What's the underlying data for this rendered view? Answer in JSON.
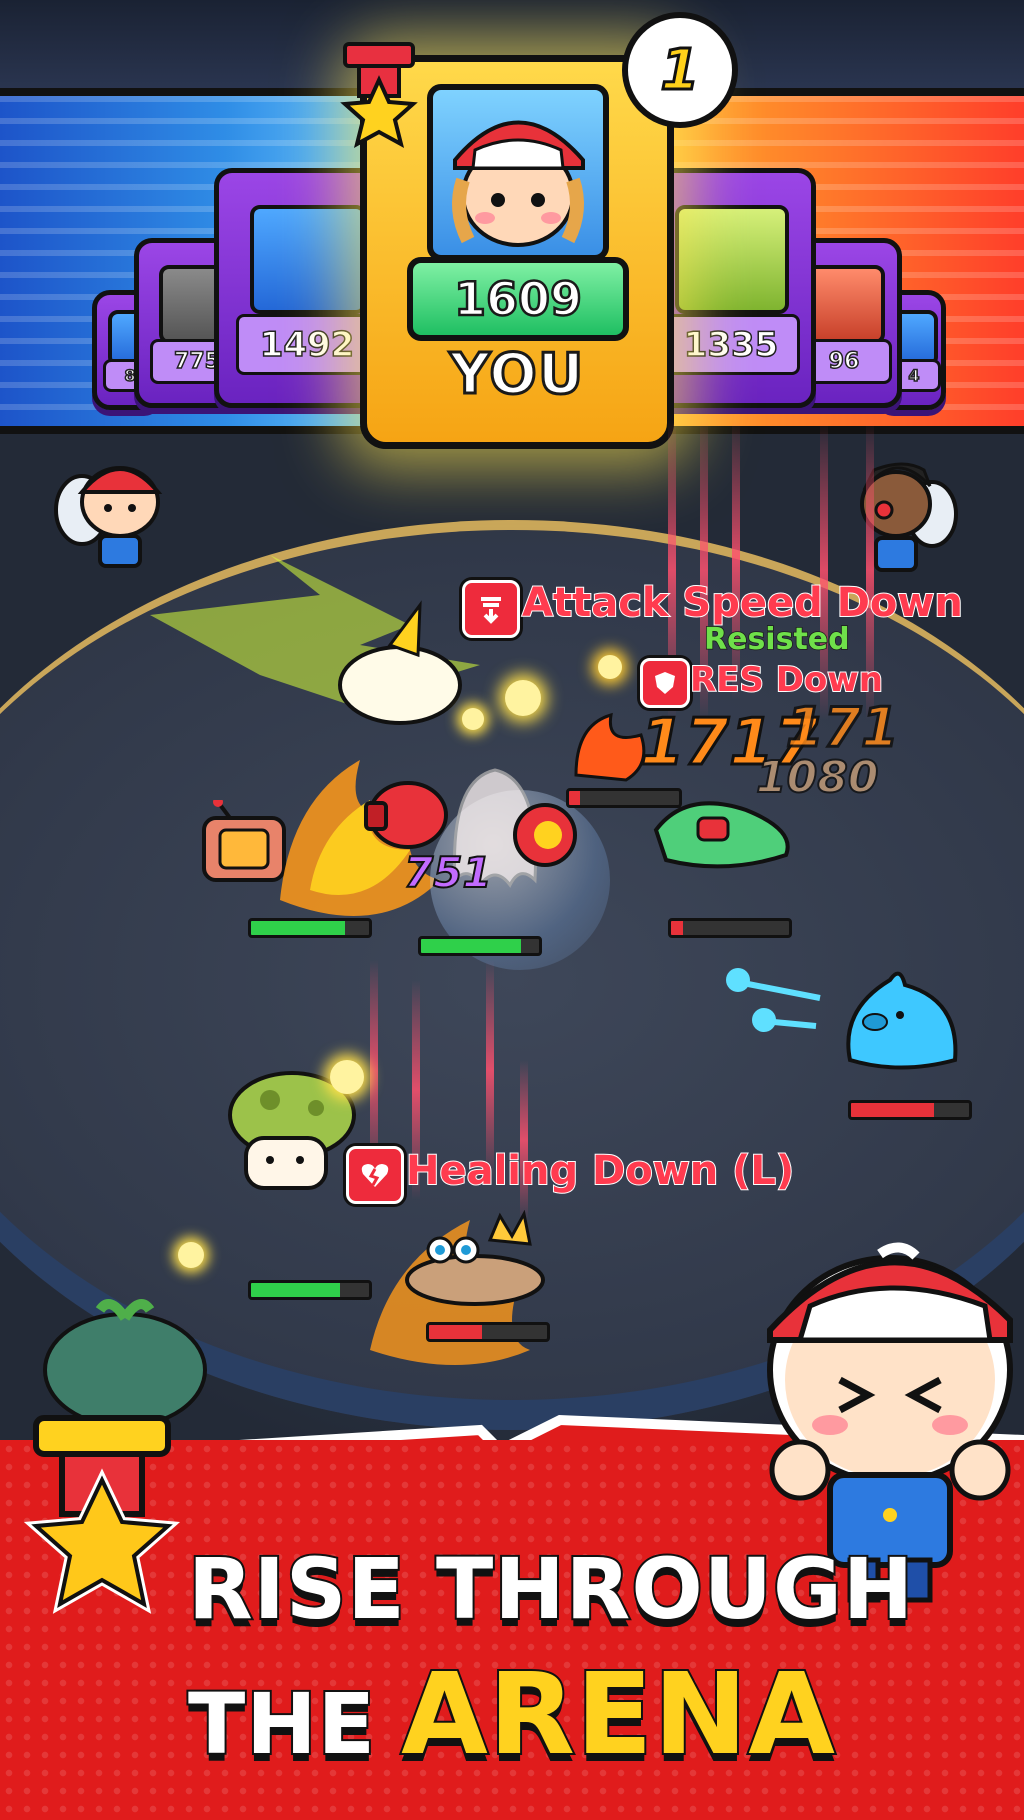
{
  "leaderboard": {
    "rank": "1",
    "player": {
      "score": "1609",
      "label": "YOU"
    },
    "left_cards": [
      {
        "score": "1492"
      },
      {
        "score": "775"
      },
      {
        "score": "8"
      }
    ],
    "right_cards": [
      {
        "score": "1335"
      },
      {
        "score": "96"
      },
      {
        "score": "4"
      }
    ]
  },
  "battle": {
    "status_effects": {
      "attack_speed_down": "Attack Speed Down",
      "resisted": "Resisted",
      "res_down": "RES Down",
      "healing_down": "Healing Down (L)"
    },
    "damage_numbers": {
      "crit_big": "1717",
      "crit_small": "171",
      "hit_1080": "1080",
      "hit_751": "751"
    },
    "health": {
      "ally_tv": 0.8,
      "ally_ghost": 0.85,
      "enemy_car": 0.1,
      "enemy_slime": 0.7,
      "ally_mushroom": 0.75,
      "enemy_crown": 0.45
    }
  },
  "promo": {
    "line1": "RISE THROUGH",
    "line2_prefix": "THE",
    "line2_highlight": "ARENA"
  },
  "colors": {
    "accent_yellow": "#ffd21f",
    "promo_red": "#e01c1c",
    "status_red": "#ff3b4f",
    "resisted_green": "#6fe04a",
    "crit_orange": "#ff8a1a",
    "damage_purple": "#c26bff"
  }
}
